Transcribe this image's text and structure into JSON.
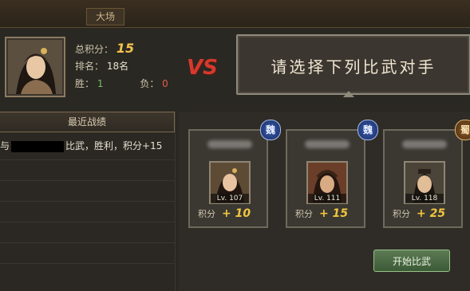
{
  "top": {
    "tab_label": "大场"
  },
  "player": {
    "total_score_label": "总积分：",
    "total_score": "15",
    "rank_label": "排名：",
    "rank_value": "18名",
    "win_label": "胜：",
    "win_value": "1",
    "lose_label": "负：",
    "lose_value": "0"
  },
  "vs_text": "VS",
  "prompt_text": "请选择下列比武对手",
  "recent": {
    "header": "最近战绩",
    "entry_prefix": "与",
    "entry_suffix": "比武，胜利，积分+15"
  },
  "opponents": [
    {
      "faction": "魏",
      "level": "Lv. 107",
      "points_label": "积分",
      "points": "+ 10"
    },
    {
      "faction": "魏",
      "level": "Lv. 111",
      "points_label": "积分",
      "points": "+ 15"
    },
    {
      "faction": "蜀",
      "level": "Lv. 118",
      "points_label": "积分",
      "points": "+ 25"
    }
  ],
  "start_button": "开始比武",
  "colors": {
    "score_gold": "#f4c44a",
    "vs_red": "#d53a2d",
    "win_green": "#6fc25f",
    "lose_red": "#e35b45"
  }
}
